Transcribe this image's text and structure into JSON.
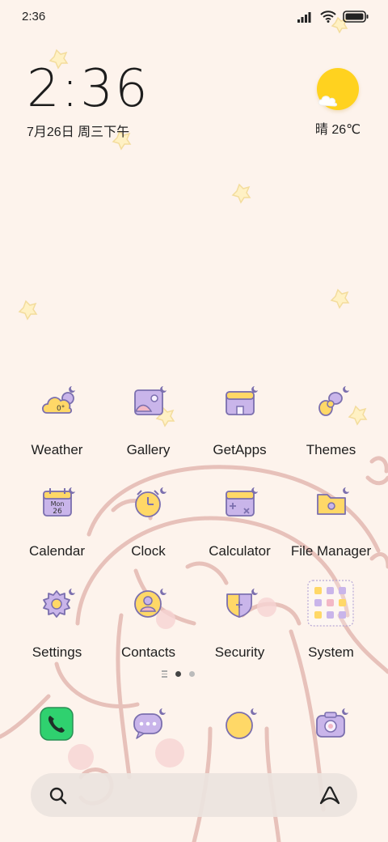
{
  "status_bar": {
    "time": "2:36",
    "icons": [
      "signal-icon",
      "wifi-icon",
      "battery-icon"
    ]
  },
  "clock_widget": {
    "time": "2:36",
    "date": "7月26日 周三下午"
  },
  "weather_widget": {
    "icon": "sun-cloud-icon",
    "text": "晴 26℃"
  },
  "apps": [
    {
      "label": "Weather",
      "icon": "weather-icon",
      "badge": "0°"
    },
    {
      "label": "Gallery",
      "icon": "gallery-icon"
    },
    {
      "label": "GetApps",
      "icon": "getapps-icon"
    },
    {
      "label": "Themes",
      "icon": "themes-icon"
    },
    {
      "label": "Calendar",
      "icon": "calendar-icon",
      "badge_month": "Mon",
      "badge_day": "26"
    },
    {
      "label": "Clock",
      "icon": "clock-icon"
    },
    {
      "label": "Calculator",
      "icon": "calculator-icon"
    },
    {
      "label": "File Manager",
      "icon": "folder-icon"
    },
    {
      "label": "Settings",
      "icon": "settings-icon"
    },
    {
      "label": "Contacts",
      "icon": "contacts-icon"
    },
    {
      "label": "Security",
      "icon": "security-icon"
    },
    {
      "label": "System",
      "icon": "system-folder-icon"
    }
  ],
  "page_indicator": {
    "pages": 2,
    "current": 1
  },
  "dock": [
    "phone-icon",
    "messages-icon",
    "browser-icon",
    "camera-icon"
  ],
  "search_bar": {
    "left_icon": "search-icon",
    "right_icon": "assistant-icon"
  },
  "colors": {
    "background": "#fdf3ec",
    "purple": "#c9b5ea",
    "outline": "#7b6fae",
    "yellow": "#ffd867",
    "pink": "#f3b8c6",
    "phone_green": "#2fd16f"
  }
}
